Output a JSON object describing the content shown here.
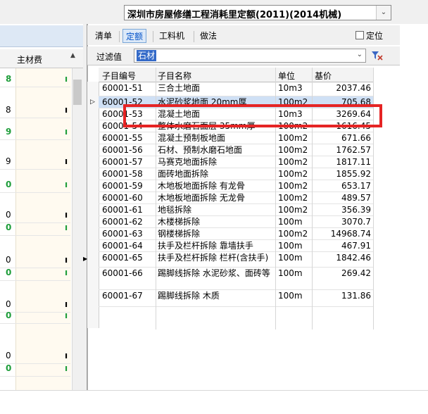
{
  "quota_selector": {
    "value": "深圳市房屋修缮工程消耗里定额(2011)(2014机械)",
    "dropdown_icon": "chevron-down-icon"
  },
  "left_pane": {
    "column_header": "主材费",
    "rows": [
      {
        "val": "8",
        "highlight": true
      },
      {
        "val": "8",
        "highlight": false
      },
      {
        "val": "9",
        "highlight": true
      },
      {
        "val": "9",
        "highlight": false
      },
      {
        "val": "0",
        "highlight": true
      },
      {
        "val": "0",
        "highlight": false
      },
      {
        "val": "0",
        "highlight": true
      },
      {
        "val": "0",
        "highlight": false
      },
      {
        "val": "0",
        "highlight": true
      },
      {
        "val": "0",
        "highlight": false
      },
      {
        "val": "0",
        "highlight": true
      },
      {
        "val": "0",
        "highlight": false
      },
      {
        "val": "0",
        "highlight": true
      }
    ]
  },
  "tabs": [
    {
      "label": "清单",
      "active": false
    },
    {
      "label": "定额",
      "active": true
    },
    {
      "label": "工料机",
      "active": false
    },
    {
      "label": "做法",
      "active": false
    }
  ],
  "locate_label": "定位",
  "filter": {
    "label": "过滤值",
    "value": "石材"
  },
  "table": {
    "headers": {
      "code": "子目编号",
      "name": "子目名称",
      "unit": "单位",
      "base": "基价"
    },
    "rows": [
      {
        "code": "60001-51",
        "name": "三合土地面",
        "unit": "10m3",
        "base": "2037.46"
      },
      {
        "code": "60001-52",
        "name": "水泥砂浆地面 20mm厚",
        "unit": "100m2",
        "base": "705.68"
      },
      {
        "code": "60001-53",
        "name": "混凝土地面",
        "unit": "10m3",
        "base": "3269.64"
      },
      {
        "code": "60001-54",
        "name": "整体水磨石面层 35mm厚",
        "unit": "100m2",
        "base": "1616.45"
      },
      {
        "code": "60001-55",
        "name": "混凝土预制板地面",
        "unit": "100m2",
        "base": "671.66"
      },
      {
        "code": "60001-56",
        "name": "石材、预制水磨石地面",
        "unit": "100m2",
        "base": "1762.57"
      },
      {
        "code": "60001-57",
        "name": "马赛克地面拆除",
        "unit": "100m2",
        "base": "1817.11"
      },
      {
        "code": "60001-58",
        "name": "面砖地面拆除",
        "unit": "100m2",
        "base": "1855.92"
      },
      {
        "code": "60001-59",
        "name": "木地板地面拆除 有龙骨",
        "unit": "100m2",
        "base": "653.17"
      },
      {
        "code": "60001-60",
        "name": "木地板地面拆除 无龙骨",
        "unit": "100m2",
        "base": "489.57"
      },
      {
        "code": "60001-61",
        "name": "地毯拆除",
        "unit": "100m2",
        "base": "356.39"
      },
      {
        "code": "60001-62",
        "name": "木楼梯拆除",
        "unit": "100m",
        "base": "3070.7"
      },
      {
        "code": "60001-63",
        "name": "钢楼梯拆除",
        "unit": "100m2",
        "base": "14968.74"
      },
      {
        "code": "60001-64",
        "name": "扶手及栏杆拆除 靠墙扶手",
        "unit": "100m",
        "base": "467.91"
      },
      {
        "code": "60001-65",
        "name": "扶手及栏杆拆除 栏杆(含扶手)",
        "unit": "100m",
        "base": "1842.46"
      },
      {
        "code": "60001-66",
        "name": "踢脚线拆除 水泥砂浆、面砖等",
        "unit": "100m",
        "base": "269.42"
      },
      {
        "code": "60001-67",
        "name": "踢脚线拆除 木质",
        "unit": "100m",
        "base": "131.86"
      }
    ]
  },
  "colors": {
    "highlight_red": "#e52424",
    "green_value": "#1e9d3a",
    "active_tab": "#0050c8"
  }
}
